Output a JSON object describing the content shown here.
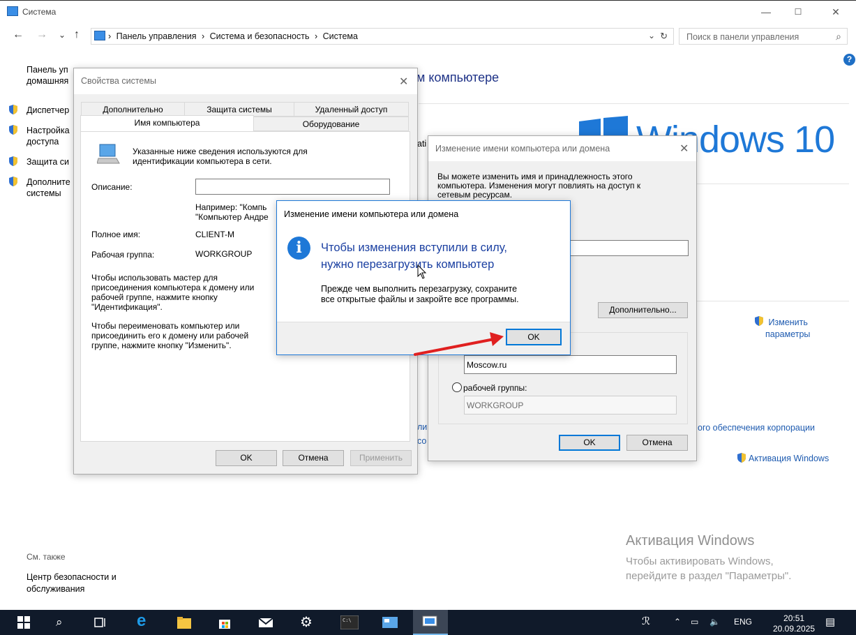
{
  "window": {
    "title": "Система",
    "minimize": "—",
    "maximize": "☐",
    "close": "✕"
  },
  "nav": {
    "back": "←",
    "forward": "→",
    "recent": "⌄",
    "up": "↑",
    "breadcrumb": [
      "Панель управления",
      "Система и безопасность",
      "Система"
    ],
    "sep": "›",
    "search_placeholder": "Поиск в панели управления"
  },
  "sidebar": {
    "home": [
      "Панель уп",
      "домашняя"
    ],
    "items": [
      {
        "label": "Диспетчер"
      },
      {
        "label": "Настройка",
        "label2": "доступа"
      },
      {
        "label": "Защита си"
      },
      {
        "label": "Дополните",
        "label2": "системы"
      }
    ],
    "see_also": "См. также",
    "see_link": [
      "Центр безопасности и",
      "обслуживания"
    ]
  },
  "main": {
    "heading": "м компьютере",
    "logo_text": "Windows 10",
    "frag1": "ati",
    "change_link": [
      "Изменить",
      "параметры"
    ],
    "corp_text": "ого обеспечения корпорации",
    "frag_li": "ли",
    "frag_so": "со",
    "activation_link": "Активация Windows",
    "watermark_title": "Активация Windows",
    "watermark_sub": [
      "Чтобы активировать Windows,",
      "перейдите в раздел \"Параметры\"."
    ]
  },
  "sys_props": {
    "title": "Свойства системы",
    "tabs_row1": [
      "Дополнительно",
      "Защита системы",
      "Удаленный доступ"
    ],
    "tabs_row2": [
      "Имя компьютера",
      "Оборудование"
    ],
    "intro": [
      "Указанные ниже сведения используются для",
      "идентификации компьютера в сети."
    ],
    "desc_label": "Описание:",
    "example": [
      "Например: \"Компь",
      "\"Компьютер Андре"
    ],
    "fullname_label": "Полное имя:",
    "fullname_value": "CLIENT-M",
    "workgroup_label": "Рабочая группа:",
    "workgroup_value": "WORKGROUP",
    "help1": [
      "Чтобы использовать мастер для",
      "присоединения компьютера к домену или",
      "рабочей группе, нажмите кнопку",
      "\"Идентификация\"."
    ],
    "help2": [
      "Чтобы переименовать компьютер или",
      "присоединить его к домену или рабочей",
      "группе, нажмите кнопку \"Изменить\"."
    ],
    "ok": "OK",
    "cancel": "Отмена",
    "apply": "Применить"
  },
  "rename_dialog": {
    "title": "Изменение имени компьютера или домена",
    "intro": [
      "Вы можете изменить имя и принадлежность этого",
      "компьютера. Изменения могут повлиять на доступ к",
      "сетевым ресурсам."
    ],
    "more": "Дополнительно...",
    "domain_value": "Moscow.ru",
    "workgroup_radio": "рабочей группы:",
    "workgroup_value": "WORKGROUP",
    "ok": "OK",
    "cancel": "Отмена"
  },
  "restart_msg": {
    "title": "Изменение имени компьютера или домена",
    "main": [
      "Чтобы изменения вступили в силу,",
      "нужно перезагрузить компьютер"
    ],
    "sub": [
      "Прежде чем выполнить перезагрузку, сохраните",
      "все открытые файлы и закройте все программы."
    ],
    "ok": "OK"
  },
  "taskbar": {
    "lang": "ENG",
    "time": "20:51",
    "date": "20.09.2025"
  },
  "colors": {
    "accent": "#0078d7",
    "link": "#1e5bb0",
    "heading": "#1e3287",
    "taskbar": "#101a2a",
    "arrow": "#e02020"
  }
}
